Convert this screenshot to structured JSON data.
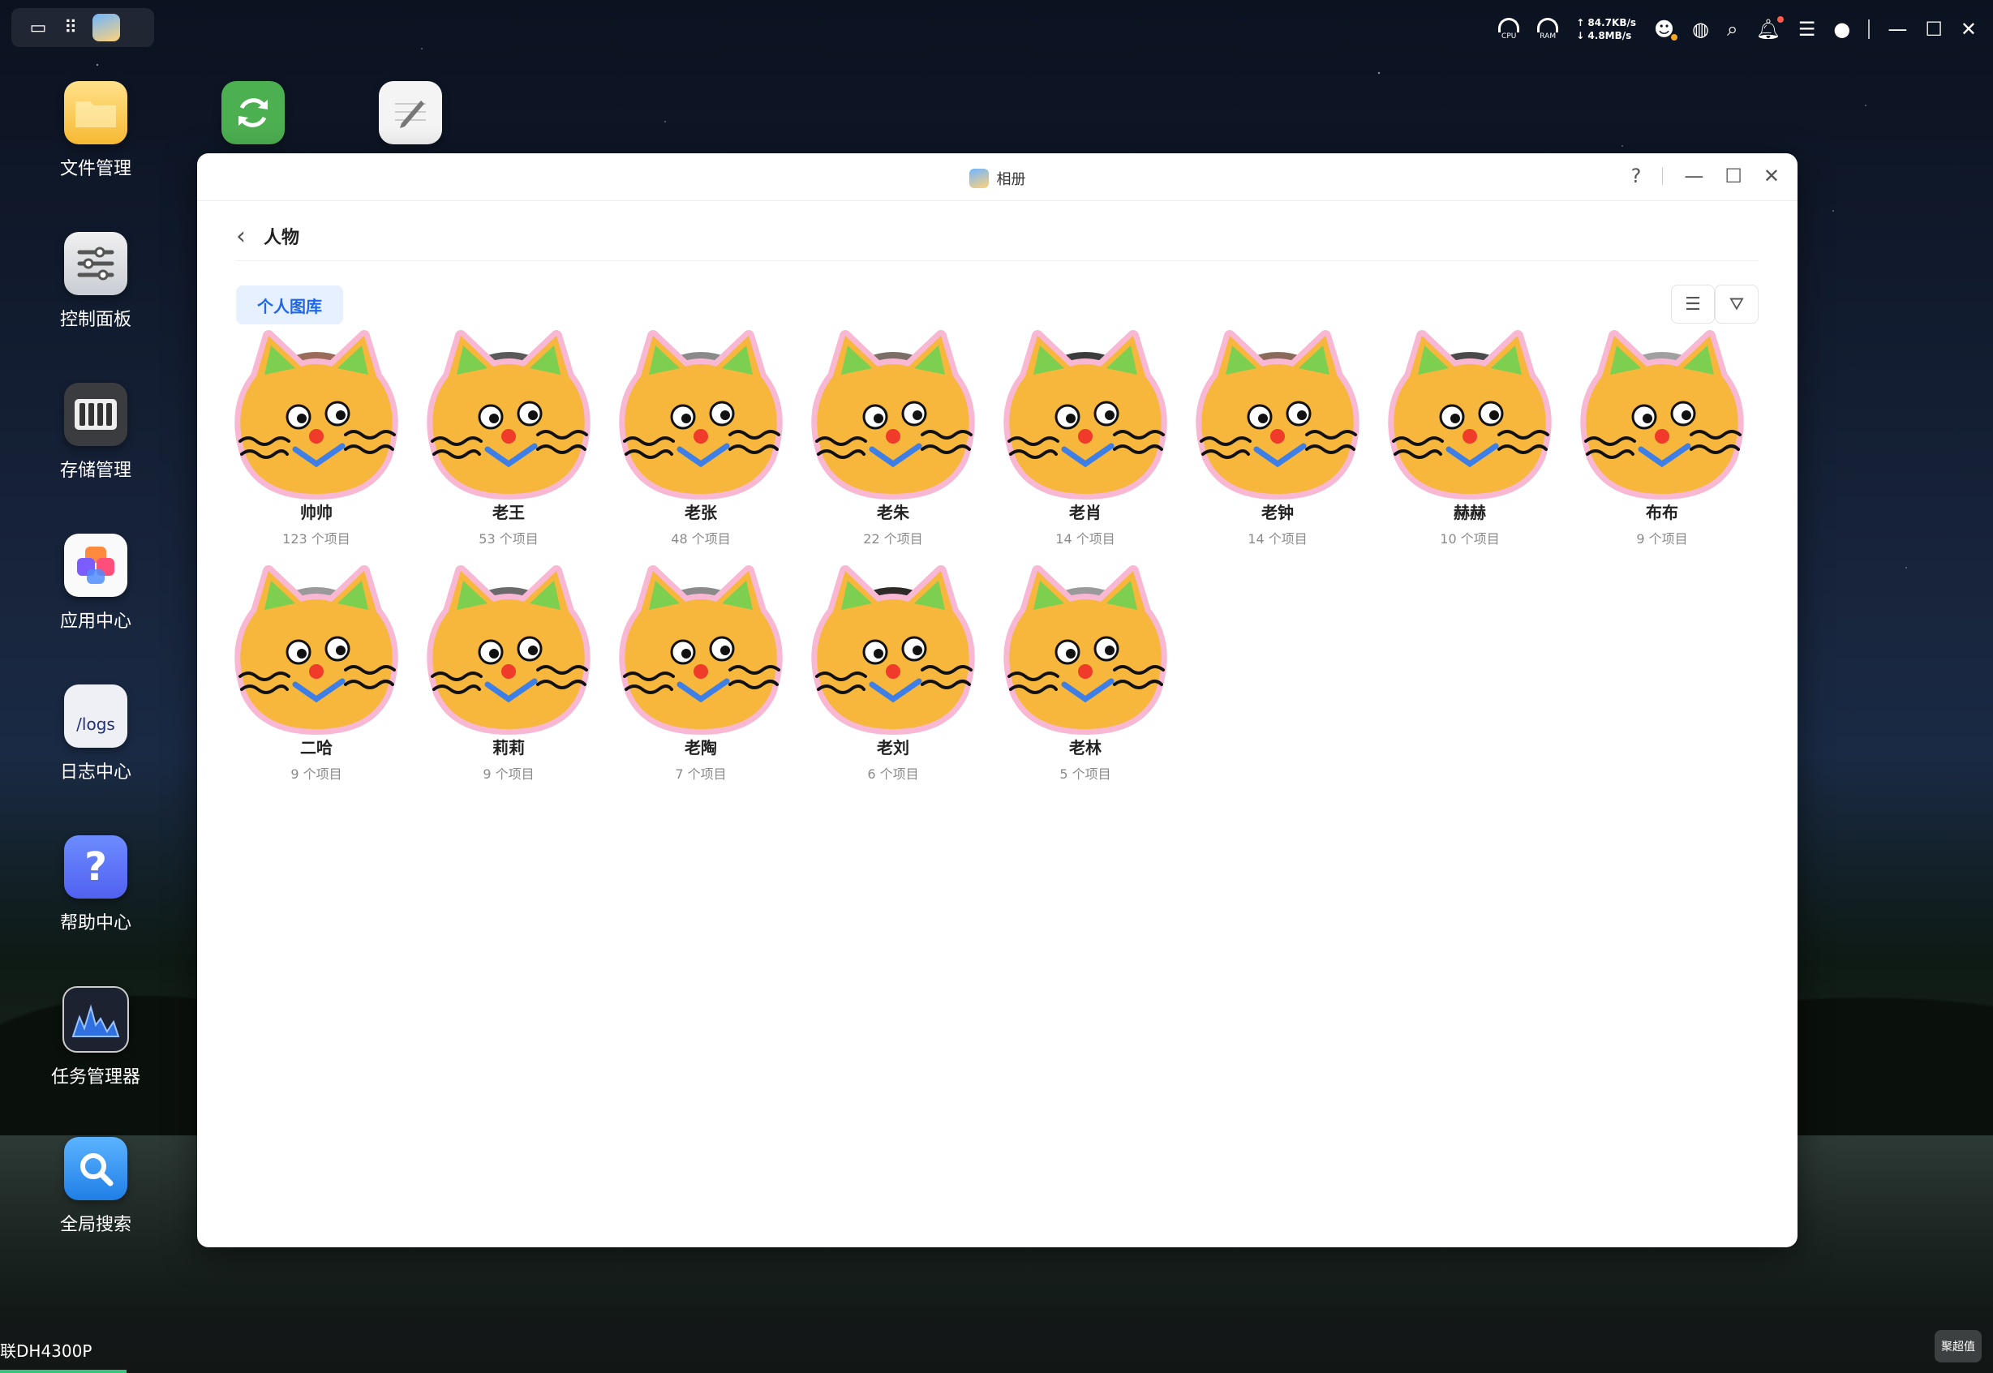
{
  "desktop": {
    "icons": [
      {
        "label": "文件管理",
        "icon": "folder-icon"
      },
      {
        "label": "控制面板",
        "icon": "sliders-icon"
      },
      {
        "label": "存储管理",
        "icon": "storage-icon"
      },
      {
        "label": "应用中心",
        "icon": "app-center-icon"
      },
      {
        "label": "日志中心",
        "icon": "logs-icon",
        "badge": "/logs"
      },
      {
        "label": "帮助中心",
        "icon": "help-icon",
        "badge": "?"
      },
      {
        "label": "任务管理器",
        "icon": "activity-monitor-icon"
      },
      {
        "label": "全局搜索",
        "icon": "search-app-icon"
      }
    ],
    "extra_icons": [
      {
        "icon": "sync-icon"
      },
      {
        "icon": "notepad-icon"
      }
    ]
  },
  "tray": {
    "cpu_label": "CPU",
    "ram_label": "RAM",
    "upload": "↑ 84.7KB/s",
    "download": "↓ 4.8MB/s"
  },
  "taskbar": {
    "device_model": "联DH4300P",
    "watermark": "聚超值"
  },
  "window": {
    "title": "相册",
    "help": "?",
    "header_title": "人物",
    "tab_label": "个人图库"
  },
  "people": [
    {
      "name": "帅帅",
      "count": "123 个项目",
      "bg": "#9a6b5a"
    },
    {
      "name": "老王",
      "count": "53 个项目",
      "bg": "#5a5a5a"
    },
    {
      "name": "老张",
      "count": "48 个项目",
      "bg": "#8a8a8a"
    },
    {
      "name": "老朱",
      "count": "22 个项目",
      "bg": "#7a6e66"
    },
    {
      "name": "老肖",
      "count": "14 个项目",
      "bg": "#3c3c3c"
    },
    {
      "name": "老钟",
      "count": "14 个项目",
      "bg": "#8a6a5a"
    },
    {
      "name": "赫赫",
      "count": "10 个项目",
      "bg": "#4a4a4a"
    },
    {
      "name": "布布",
      "count": "9 个项目",
      "bg": "#a0a0a0"
    },
    {
      "name": "二哈",
      "count": "9 个项目",
      "bg": "#9a9a9a"
    },
    {
      "name": "莉莉",
      "count": "9 个项目",
      "bg": "#6a6a6a"
    },
    {
      "name": "老陶",
      "count": "7 个项目",
      "bg": "#8a8a8a"
    },
    {
      "name": "老刘",
      "count": "6 个项目",
      "bg": "#2e2a28"
    },
    {
      "name": "老林",
      "count": "5 个项目",
      "bg": "#9a9a9a"
    }
  ]
}
